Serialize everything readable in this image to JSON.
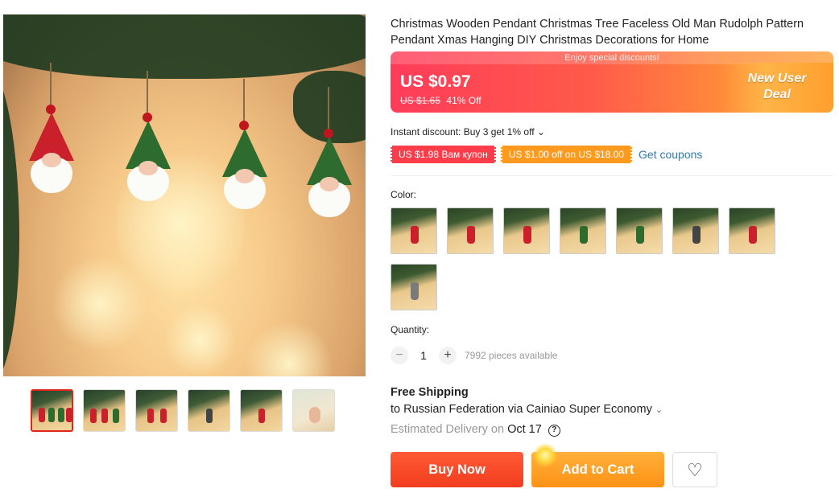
{
  "product": {
    "title": "Christmas Wooden Pendant Christmas Tree Faceless Old Man Rudolph Pattern Pendant Xmas Hanging DIY Christmas Decorations for Home"
  },
  "price": {
    "banner": "Enjoy special discounts!",
    "current": "US $0.97",
    "original": "US $1.65",
    "discount": "41% Off",
    "promo_line1": "New User",
    "promo_line2": "Deal"
  },
  "instant_discount": "Instant discount: Buy 3 get 1% off ⌄",
  "coupons": {
    "items": [
      "US $1.98 Вам купон",
      "US $1.00 off on US $18.00"
    ],
    "get_link": "Get coupons"
  },
  "color": {
    "label": "Color:",
    "swatch_colors": [
      "#c9202b",
      "#c9202b",
      "#c9202b",
      "#2d6b2f",
      "#2d6b2f",
      "#444444",
      "#c9202b",
      "#7a7a7a"
    ],
    "selected_index": -1
  },
  "quantity": {
    "label": "Quantity:",
    "minus": "−",
    "value": "1",
    "plus": "+",
    "available": "7992 pieces available"
  },
  "shipping": {
    "title": "Free Shipping",
    "to": "to Russian Federation via Cainiao Super Economy",
    "chevron": "⌄",
    "eta_prefix": "Estimated Delivery on",
    "eta_date": "Oct 17",
    "help": "?"
  },
  "actions": {
    "buy_now": "Buy Now",
    "add_to_cart": "Add to Cart",
    "wishlist_icon": "heart-outline-icon",
    "wishlist_glyph": "♡"
  },
  "gallery": {
    "thumb_count": 6,
    "active_index": 0
  },
  "colors": {
    "accent_red": "#e1251b",
    "buy_now": "#f23d1f",
    "add_to_cart": "#ff9216",
    "link": "#2e7bb5"
  }
}
